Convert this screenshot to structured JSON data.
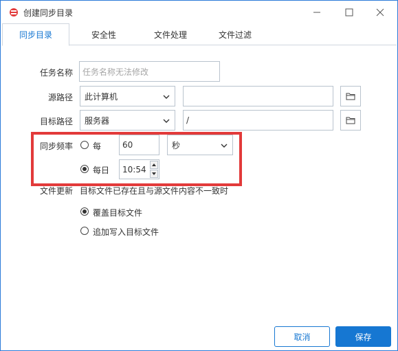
{
  "window": {
    "title": "创建同步目录",
    "controls": {
      "minimize": "minimize-icon",
      "maximize": "maximize-icon",
      "close": "close-icon"
    }
  },
  "tabs": [
    {
      "label": "同步目录",
      "active": true
    },
    {
      "label": "安全性",
      "active": false
    },
    {
      "label": "文件处理",
      "active": false
    },
    {
      "label": "文件过滤",
      "active": false
    }
  ],
  "form": {
    "task_name": {
      "label": "任务名称",
      "placeholder": "任务名称无法修改"
    },
    "source_path": {
      "label": "源路径",
      "location": "此计算机",
      "path": ""
    },
    "target_path": {
      "label": "目标路径",
      "location": "服务器",
      "path": "/"
    },
    "sync_frequency": {
      "label": "同步频率",
      "option_every": {
        "label": "每",
        "checked": false,
        "value": "60",
        "unit": "秒"
      },
      "option_daily": {
        "label": "每日",
        "checked": true,
        "time": "10:54"
      }
    },
    "file_update": {
      "label": "文件更新",
      "note": "目标文件已存在且与源文件内容不一致时",
      "options": [
        {
          "label": "覆盖目标文件",
          "checked": true
        },
        {
          "label": "追加写入目标文件",
          "checked": false
        }
      ]
    }
  },
  "footer": {
    "cancel_label": "取消",
    "save_label": "保存"
  },
  "colors": {
    "accent": "#1677d2",
    "highlight": "#e23a3a",
    "border": "#b9c3cd"
  }
}
